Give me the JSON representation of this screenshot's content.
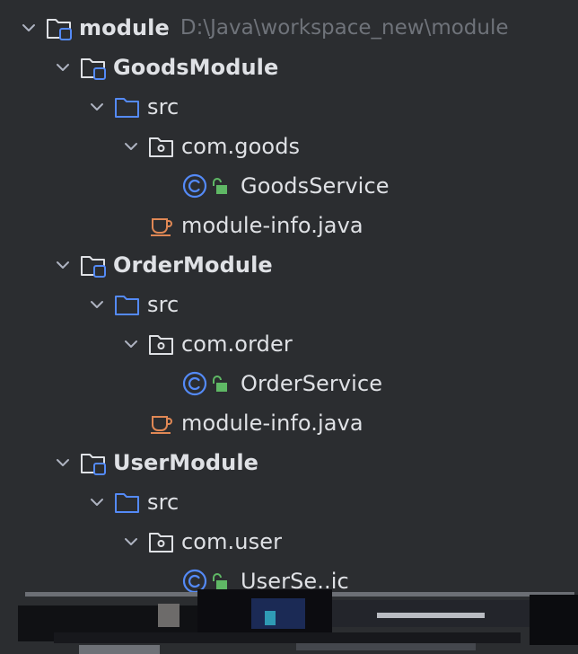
{
  "project_tree": {
    "root": {
      "label": "module",
      "path": "D:\\Java\\workspace_new\\module",
      "icon": "module-folder-icon"
    },
    "modules": [
      {
        "label": "GoodsModule",
        "src_label": "src",
        "package_label": "com.goods",
        "class_label": "GoodsService",
        "module_info_label": "module-info.java"
      },
      {
        "label": "OrderModule",
        "src_label": "src",
        "package_label": "com.order",
        "class_label": "OrderService",
        "module_info_label": "module-info.java"
      },
      {
        "label": "UserModule",
        "src_label": "src",
        "package_label": "com.user",
        "class_label": "UserSe..ic"
      }
    ]
  },
  "colors": {
    "background": "#2b2d30",
    "text": "#dfe1e5",
    "path_text": "#6f737a",
    "folder_blue": "#548af7",
    "class_blue": "#548af7",
    "lock_green": "#5fb865",
    "java_orange": "#e08855"
  }
}
